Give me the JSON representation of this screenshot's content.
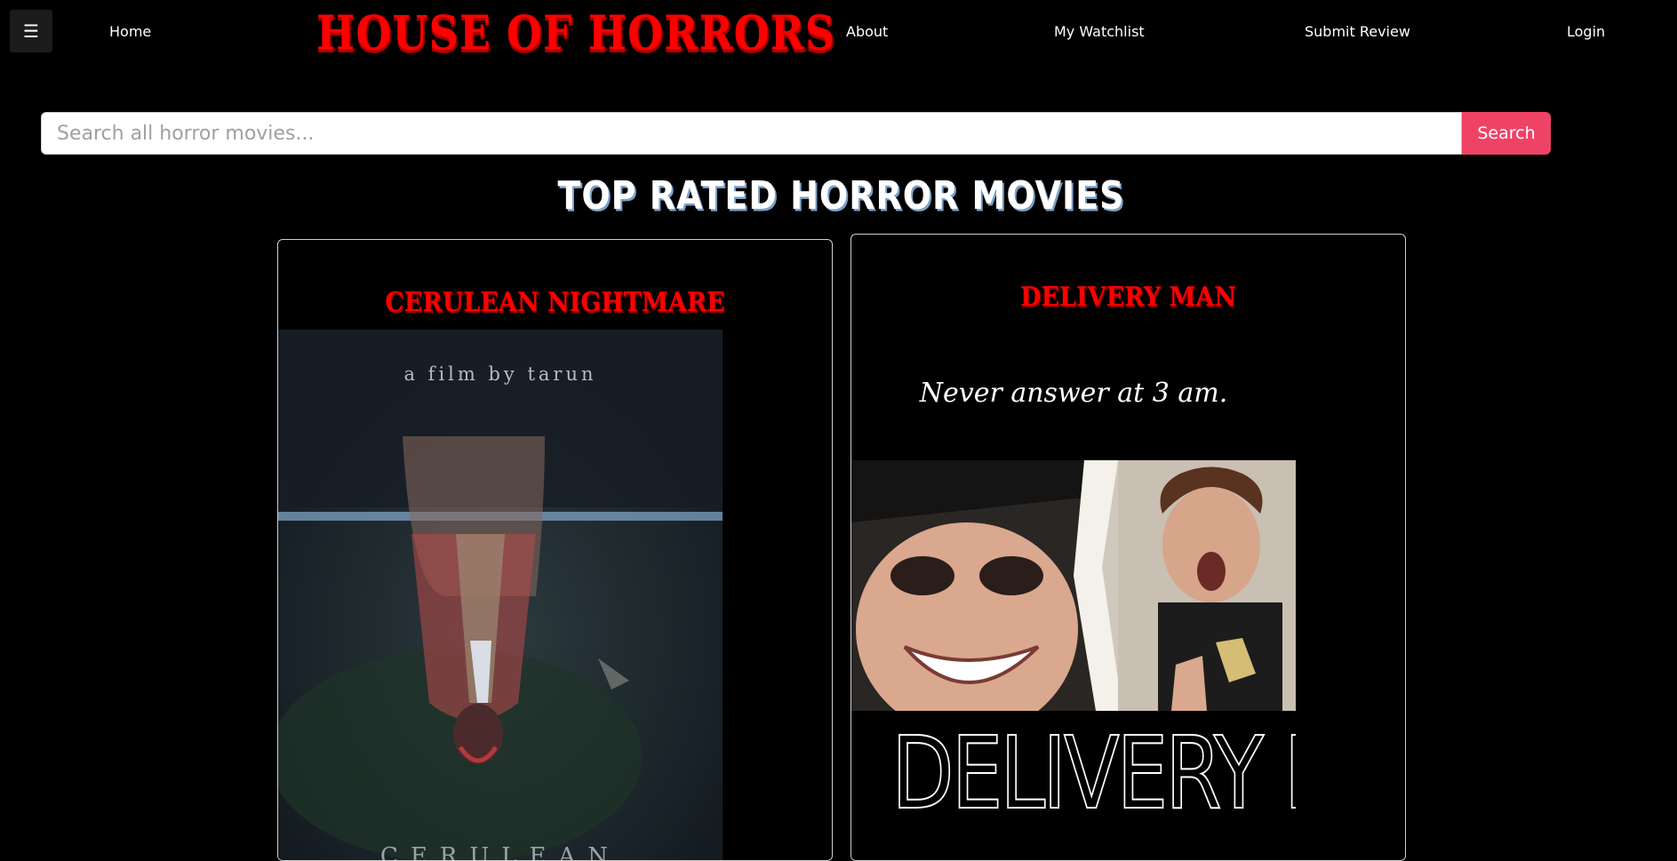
{
  "nav": {
    "menu_icon": "☰",
    "home": "Home",
    "brand": "HOUSE OF HORRORS",
    "about": "About",
    "watchlist": "My Watchlist",
    "submit_review": "Submit Review",
    "login": "Login"
  },
  "search": {
    "placeholder": "Search all horror movies...",
    "button": "Search"
  },
  "section": {
    "title": "TOP RATED HORROR MOVIES"
  },
  "movies": [
    {
      "title": "CERULEAN NIGHTMARE",
      "poster_credit": "a film by tarun",
      "poster_bottom_text": "CERULEAN"
    },
    {
      "title": "DELIVERY MAN",
      "poster_tagline": "Never answer at 3 am.",
      "poster_title": "DELIVERY MAN"
    }
  ],
  "colors": {
    "brand_red": "#ff0000",
    "search_button": "#ef4366",
    "background": "#000000"
  }
}
